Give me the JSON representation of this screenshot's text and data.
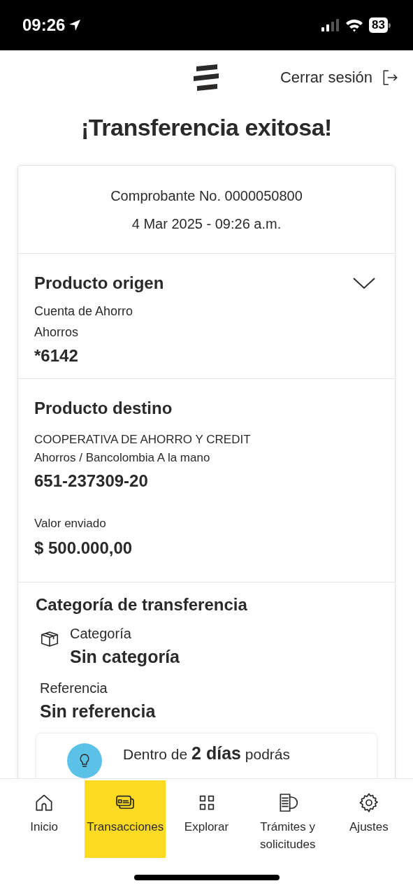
{
  "status_bar": {
    "time": "09:26",
    "battery": "83"
  },
  "header": {
    "logout": "Cerrar sesión"
  },
  "title": "¡Transferencia exitosa!",
  "receipt": {
    "number": "Comprobante No. 0000050800",
    "date": "4 Mar 2025 - 09:26 a.m."
  },
  "origin": {
    "heading": "Producto origen",
    "expanded": false,
    "lines": [
      "Cuenta de Ahorro",
      "Ahorros"
    ],
    "account": "*6142"
  },
  "destination": {
    "heading": "Producto destino",
    "lines": [
      "COOPERATIVA DE AHORRO Y CREDIT",
      "Ahorros / Bancolombia A la mano"
    ],
    "account": "651-237309-20",
    "amount_label": "Valor enviado",
    "amount": "$ 500.000,00"
  },
  "category": {
    "heading": "Categoría de transferencia",
    "category_label": "Categoría",
    "category_value": "Sin categoría",
    "reference_label": "Referencia",
    "reference_value": "Sin referencia"
  },
  "tip": {
    "text": "Dentro de **2 días** podrás"
  },
  "nav": [
    {
      "label": "Inicio",
      "kind": "home",
      "selected": false
    },
    {
      "label": "Transacciones",
      "kind": "cards",
      "selected": true
    },
    {
      "label": "Explorar",
      "kind": "grid",
      "selected": false
    },
    {
      "label": "Trámites y solicitudes",
      "kind": "docs",
      "selected": false
    },
    {
      "label": "Ajustes",
      "kind": "gear",
      "selected": false
    }
  ]
}
